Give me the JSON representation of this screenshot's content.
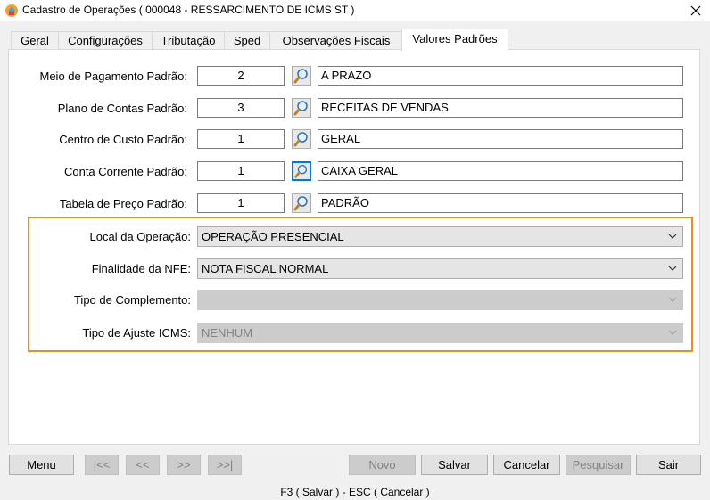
{
  "window": {
    "title": "Cadastro de Operações ( 000048 - RESSARCIMENTO DE ICMS ST )",
    "close_glyph": "✕"
  },
  "tabs": [
    {
      "label": "Geral"
    },
    {
      "label": "Configurações"
    },
    {
      "label": "Tributação"
    },
    {
      "label": "Sped"
    },
    {
      "label": "Observações Fiscais"
    },
    {
      "label": "Valores Padrões",
      "active": true
    }
  ],
  "defaults": [
    {
      "label": "Meio de Pagamento Padrão:",
      "code": "2",
      "description": "A PRAZO"
    },
    {
      "label": "Plano de Contas Padrão:",
      "code": "3",
      "description": "RECEITAS DE VENDAS"
    },
    {
      "label": "Centro de Custo Padrão:",
      "code": "1",
      "description": "GERAL"
    },
    {
      "label": "Conta Corrente Padrão:",
      "code": "1",
      "description": "CAIXA GERAL",
      "lookup_focused": true
    },
    {
      "label": "Tabela de Preço Padrão:",
      "code": "1",
      "description": "PADRÃO"
    }
  ],
  "nfe_group": {
    "border_color": "#f08a24",
    "fields": [
      {
        "label": "Local da Operação:",
        "value": "OPERAÇÃO PRESENCIAL",
        "enabled": true
      },
      {
        "label": "Finalidade da NFE:",
        "value": "NOTA FISCAL NORMAL",
        "enabled": true
      },
      {
        "label": "Tipo de Complemento:",
        "value": "",
        "enabled": false
      },
      {
        "label": "Tipo de Ajuste ICMS:",
        "value": "NENHUM",
        "enabled": false
      }
    ]
  },
  "buttons": {
    "menu": "Menu",
    "first": "|<<",
    "prev": "<<",
    "next": ">>",
    "last": ">>|",
    "novo": "Novo",
    "salvar": "Salvar",
    "cancelar": "Cancelar",
    "pesquisar": "Pesquisar",
    "sair": "Sair"
  },
  "status_bar": "F3 ( Salvar )  -  ESC ( Cancelar )",
  "colors": {
    "accent": "#0078d7",
    "group_border": "#f08a24"
  }
}
